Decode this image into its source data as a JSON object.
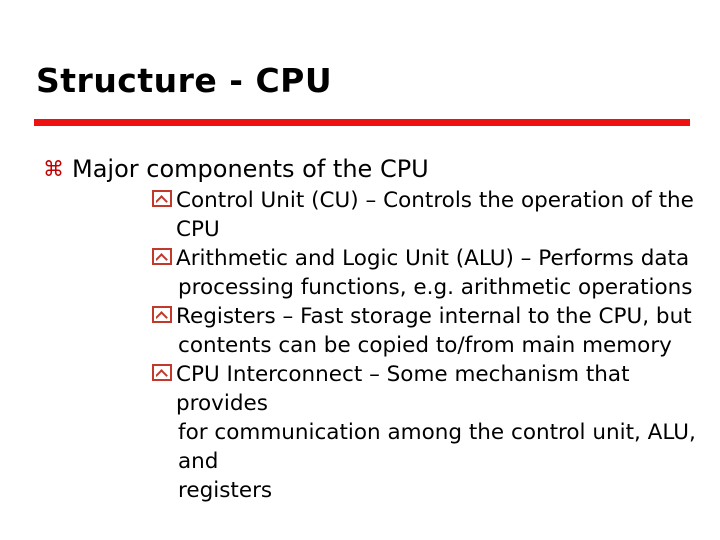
{
  "slide": {
    "title": "Structure - CPU",
    "accent_color": "#EE1111",
    "bullet_marker_color": "#C00000",
    "sub_marker_color": "#C0392B",
    "text_color": "#000000",
    "background_color": "#FFFFFF",
    "rule": {
      "name": "title-underline-rule",
      "color": "#EE1111"
    },
    "bullets": [
      {
        "marker_icon": "place-of-interest-icon",
        "marker_glyph": "⌘",
        "text": "Major components of the CPU",
        "children": [
          {
            "marker_icon": "chevron-in-box-icon",
            "lines": [
              "Control Unit (CU) – Controls the operation of the CPU"
            ]
          },
          {
            "marker_icon": "chevron-in-box-icon",
            "lines": [
              "Arithmetic and Logic Unit (ALU) – Performs data",
              "processing functions, e.g. arithmetic operations"
            ]
          },
          {
            "marker_icon": "chevron-in-box-icon",
            "lines": [
              "Registers – Fast storage internal to the CPU, but",
              "contents can be copied to/from main memory"
            ]
          },
          {
            "marker_icon": "chevron-in-box-icon",
            "lines": [
              "CPU Interconnect – Some mechanism that provides",
              "for communication among the control unit, ALU, and",
              "registers"
            ]
          }
        ]
      }
    ]
  }
}
